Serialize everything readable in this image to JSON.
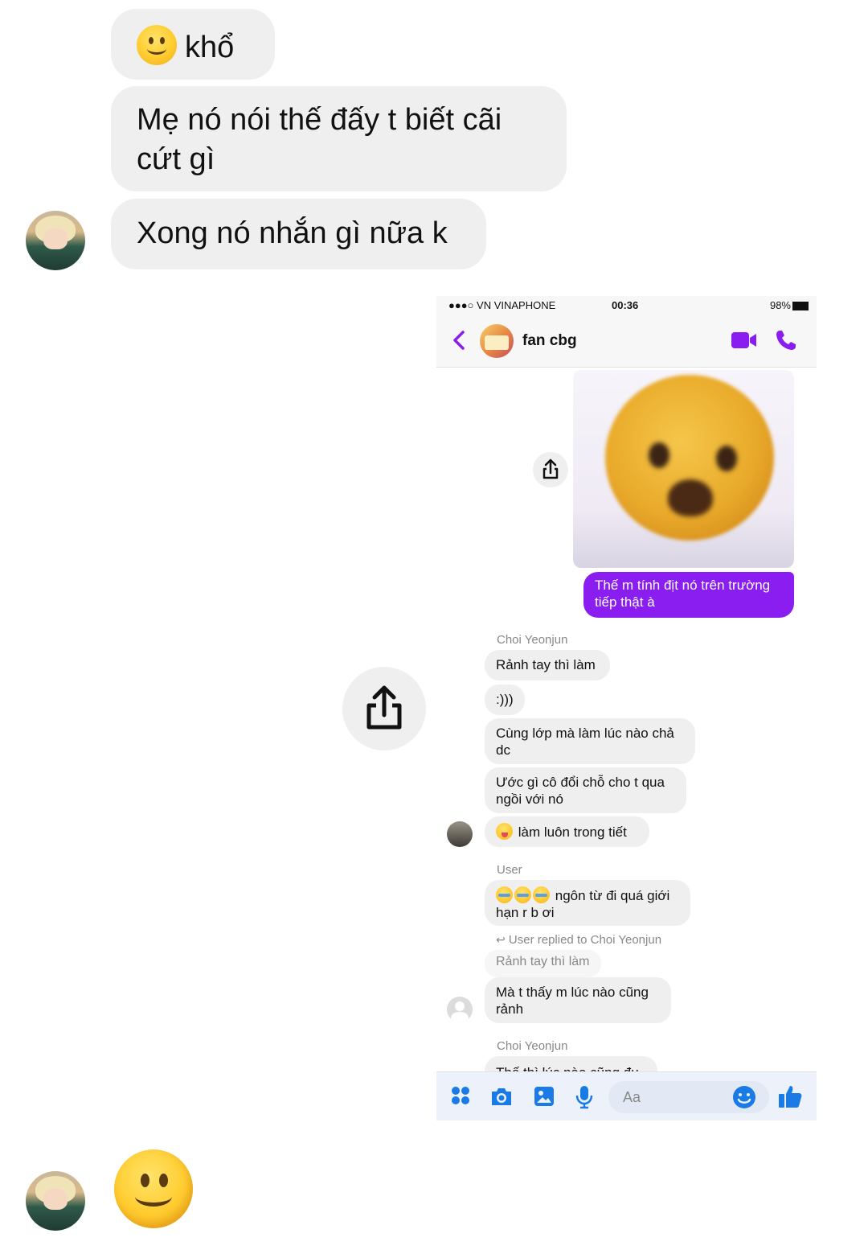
{
  "conversation": {
    "messages": [
      {
        "emoji": "slightly-smiling-face",
        "text": "khổ"
      },
      {
        "text": "Mẹ nó nói thế đấy t biết cãi cứt gì"
      },
      {
        "text": "Xong nó nhắn gì nữa k"
      }
    ],
    "last_emoji": "slightly-smiling-face"
  },
  "screenshot": {
    "status_bar": {
      "carrier": "●●●○ VN VINAPHONE",
      "time": "00:36",
      "battery": "98%"
    },
    "header": {
      "group_name": "fan cbg"
    },
    "my_message": "Thế m tính địt nó trên trường tiếp thật à",
    "groups": [
      {
        "sender": "Choi Yeonjun",
        "messages": [
          "Rảnh tay thì làm",
          ":)))",
          "Cùng lớp mà làm lúc nào chả dc",
          "Ước gì cô đổi chỗ cho t qua ngồi với nó",
          "làm luôn trong tiết"
        ]
      },
      {
        "sender": "User",
        "messages": [
          "ngôn từ đi quá giới hạn r b ơi"
        ],
        "reply_note": "User replied to Choi Yeonjun",
        "reply_quote": "Rảnh tay thì làm",
        "reply_message": "Mà t thấy m lúc nào cũng rảnh"
      },
      {
        "sender": "Choi Yeonjun",
        "messages": [
          "Thế thì lúc nào cũng đụ"
        ]
      }
    ],
    "composer": {
      "placeholder": "Aa"
    }
  },
  "colors": {
    "bubble_gray": "#efefef",
    "messenger_purple": "#8a1df0",
    "messenger_blue": "#1a7ae6"
  },
  "icons": [
    "back-chevron-icon",
    "video-call-icon",
    "phone-call-icon",
    "share-icon",
    "apps-icon",
    "camera-icon",
    "gallery-icon",
    "microphone-icon",
    "emoji-icon",
    "like-icon"
  ]
}
